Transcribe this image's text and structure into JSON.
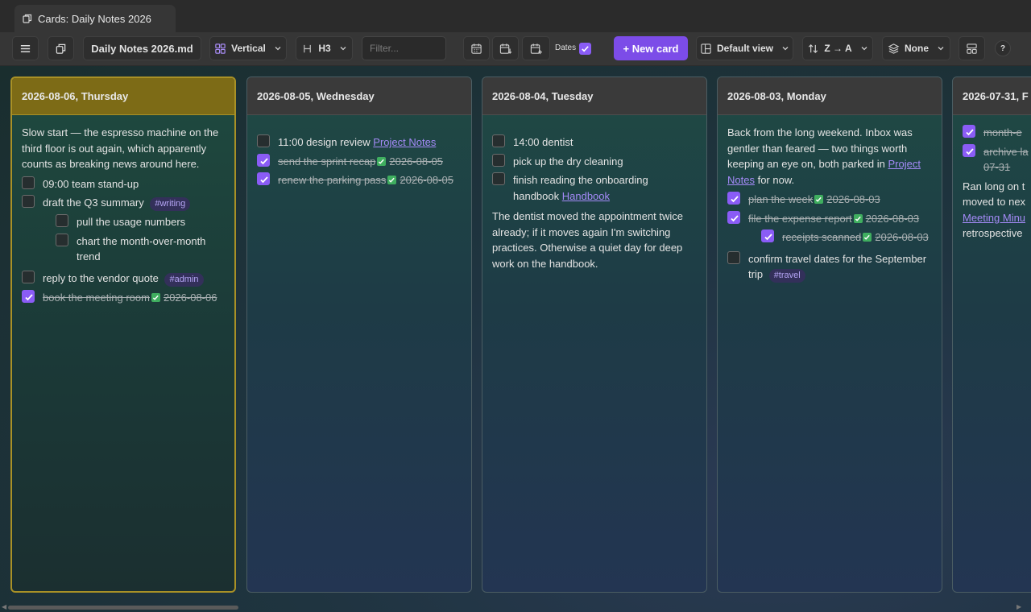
{
  "tab": {
    "title": "Cards: Daily Notes 2026"
  },
  "toolbar": {
    "file": "Daily Notes 2026.md",
    "layout": "Vertical",
    "heading": "H3",
    "filter_placeholder": "Filter...",
    "dates_label": "Dates",
    "new_card": "+ New card",
    "view": "Default view",
    "sort": "Z → A",
    "group": "None",
    "help": "?"
  },
  "cards": [
    {
      "date": "2026-08-06, Thursday",
      "intro": "Slow start — the espresso machine on the third floor is out again, which apparently counts as breaking news around here.",
      "tasks": [
        {
          "text": "09:00 team stand-up"
        },
        {
          "text": "draft the Q3 summary",
          "tag": "#writing"
        },
        {
          "text": "pull the usage numbers"
        },
        {
          "text": "chart the month-over-month trend"
        },
        {
          "text": "reply to the vendor quote",
          "tag": "#admin"
        },
        {
          "text": "book the meeting room",
          "date": "2026-08-06"
        }
      ]
    },
    {
      "date": "2026-08-05, Wednesday",
      "tasks": [
        {
          "text": "11:00 design review",
          "link": "Project Notes"
        },
        {
          "text": "send the sprint recap",
          "date": "2026-08-05"
        },
        {
          "text": "renew the parking pass",
          "date": "2026-08-05"
        }
      ]
    },
    {
      "date": "2026-08-04, Tuesday",
      "tasks": [
        {
          "text": "14:00 dentist"
        },
        {
          "text": "pick up the dry cleaning"
        },
        {
          "text": "finish reading the onboarding handbook",
          "link": "Handbook"
        }
      ],
      "outro": "The dentist moved the appointment twice already; if it moves again I'm switching practices. Otherwise a quiet day for deep work on the handbook."
    },
    {
      "date": "2026-08-03, Monday",
      "intro": "Back from the long weekend. Inbox was gentler than feared — two things worth keeping an eye on, both parked in",
      "intro_link": "Project Notes",
      "intro_tail": "for now.",
      "tasks": [
        {
          "text": "plan the week",
          "date": "2026-08-03"
        },
        {
          "text": "file the expense report",
          "date": "2026-08-03"
        },
        {
          "text": "receipts scanned",
          "date": "2026-08-03"
        },
        {
          "text": "confirm travel dates for the September trip",
          "tag": "#travel"
        }
      ]
    },
    {
      "date": "2026-07-31, F",
      "tasks": [
        {
          "text": "month-e"
        },
        {
          "text": "archive la",
          "date": "07-31"
        }
      ],
      "outro_a": "Ran long on t",
      "outro_b": "moved to nex",
      "outro_link": "Meeting Minu",
      "outro_c": "retrospective"
    }
  ]
}
